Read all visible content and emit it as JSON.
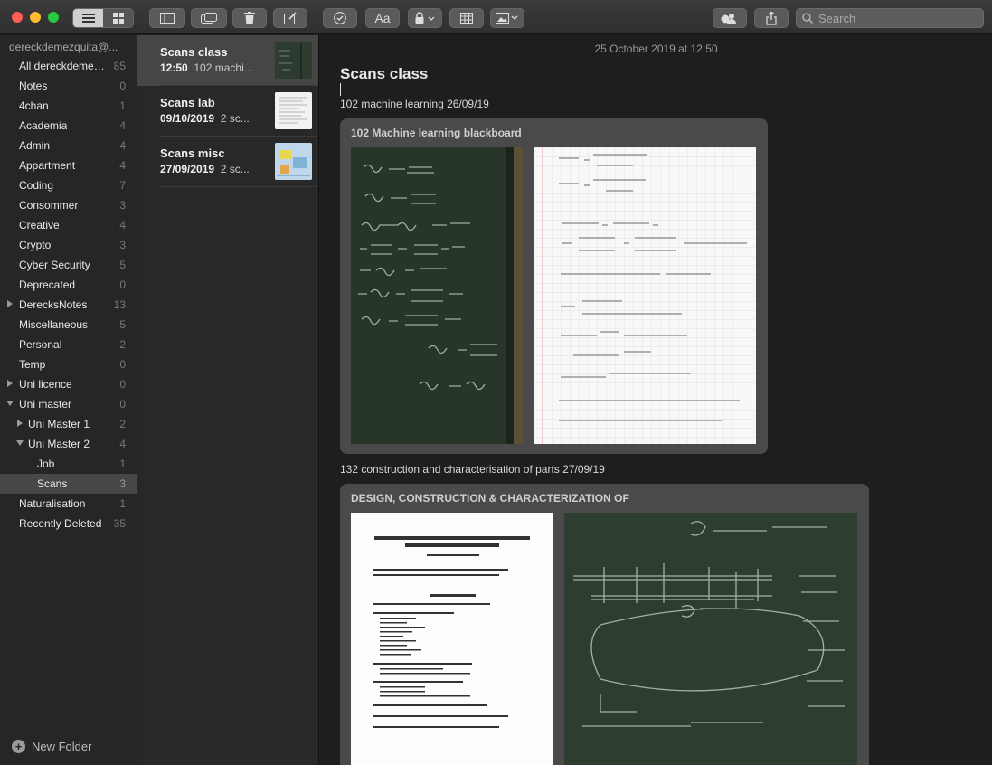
{
  "toolbar": {
    "buttons": [
      "list-view",
      "gallery-view",
      "toggle-sidebar",
      "attachments",
      "delete",
      "compose",
      "checklist",
      "format",
      "lock",
      "table",
      "media",
      "share-people",
      "share"
    ],
    "format_label": "Aa",
    "search_placeholder": "Search"
  },
  "sidebar": {
    "account": "dereckdemezquita@...",
    "folders": [
      {
        "name": "All dereckdemez...",
        "count": "85"
      },
      {
        "name": "Notes",
        "count": "0"
      },
      {
        "name": "4chan",
        "count": "1"
      },
      {
        "name": "Academia",
        "count": "4"
      },
      {
        "name": "Admin",
        "count": "4"
      },
      {
        "name": "Appartment",
        "count": "4"
      },
      {
        "name": "Coding",
        "count": "7"
      },
      {
        "name": "Consommer",
        "count": "3"
      },
      {
        "name": "Creative",
        "count": "4"
      },
      {
        "name": "Crypto",
        "count": "3"
      },
      {
        "name": "Cyber Security",
        "count": "5"
      },
      {
        "name": "Deprecated",
        "count": "0"
      },
      {
        "name": "DerecksNotes",
        "count": "13"
      },
      {
        "name": "Miscellaneous",
        "count": "5"
      },
      {
        "name": "Personal",
        "count": "2"
      },
      {
        "name": "Temp",
        "count": "0"
      },
      {
        "name": "Uni licence",
        "count": "0"
      },
      {
        "name": "Uni master",
        "count": "0"
      },
      {
        "name": "Uni Master 1",
        "count": "2"
      },
      {
        "name": "Uni Master 2",
        "count": "4"
      },
      {
        "name": "Job",
        "count": "1"
      },
      {
        "name": "Scans",
        "count": "3"
      },
      {
        "name": "Naturalisation",
        "count": "1"
      },
      {
        "name": "Recently Deleted",
        "count": "35"
      }
    ],
    "new_folder": "New Folder"
  },
  "notes": [
    {
      "title": "Scans class",
      "date": "12:50",
      "preview": "102 machi..."
    },
    {
      "title": "Scans lab",
      "date": "09/10/2019",
      "preview": "2 sc..."
    },
    {
      "title": "Scans misc",
      "date": "27/09/2019",
      "preview": "2 sc..."
    }
  ],
  "editor": {
    "date": "25 October 2019 at 12:50",
    "title": "Scans class",
    "line1": "102 machine learning 26/09/19",
    "scan1_label": "102 Machine learning blackboard",
    "line2": "132 construction and characterisation of parts 27/09/19",
    "scan2_label": "DESIGN, CONSTRUCTION & CHARACTERIZATION OF"
  },
  "colors": {
    "selected_row": "#474747",
    "traffic_red": "#fe5f57",
    "traffic_yellow": "#febc2e",
    "traffic_green": "#28c840",
    "blackboard": "#2b3a2e"
  }
}
